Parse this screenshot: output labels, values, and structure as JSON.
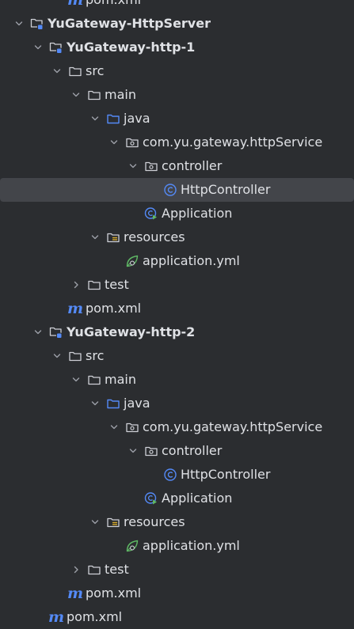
{
  "tree": [
    {
      "label": "pom.xml",
      "icon": "maven-icon",
      "depth": 2,
      "chevron": "none",
      "bold": false
    },
    {
      "label": "YuGateway-HttpServer",
      "icon": "module-folder-icon",
      "depth": 0,
      "chevron": "expanded",
      "bold": true
    },
    {
      "label": "YuGateway-http-1",
      "icon": "module-folder-icon",
      "depth": 1,
      "chevron": "expanded",
      "bold": true
    },
    {
      "label": "src",
      "icon": "folder-icon",
      "depth": 2,
      "chevron": "expanded",
      "bold": false
    },
    {
      "label": "main",
      "icon": "folder-icon",
      "depth": 3,
      "chevron": "expanded",
      "bold": false
    },
    {
      "label": "java",
      "icon": "source-root-folder-icon",
      "depth": 4,
      "chevron": "expanded",
      "bold": false
    },
    {
      "label": "com.yu.gateway.httpService",
      "icon": "package-icon",
      "depth": 5,
      "chevron": "expanded",
      "bold": false
    },
    {
      "label": "controller",
      "icon": "package-icon",
      "depth": 6,
      "chevron": "expanded",
      "bold": false
    },
    {
      "label": "HttpController",
      "icon": "java-class-icon",
      "depth": 7,
      "chevron": "none",
      "bold": false,
      "selected": true
    },
    {
      "label": "Application",
      "icon": "spring-boot-class-icon",
      "depth": 6,
      "chevron": "none",
      "bold": false
    },
    {
      "label": "resources",
      "icon": "resources-folder-icon",
      "depth": 4,
      "chevron": "expanded",
      "bold": false
    },
    {
      "label": "application.yml",
      "icon": "spring-config-icon",
      "depth": 5,
      "chevron": "none",
      "bold": false
    },
    {
      "label": "test",
      "icon": "folder-icon",
      "depth": 3,
      "chevron": "collapsed",
      "bold": false
    },
    {
      "label": "pom.xml",
      "icon": "maven-icon",
      "depth": 2,
      "chevron": "none",
      "bold": false
    },
    {
      "label": "YuGateway-http-2",
      "icon": "module-folder-icon",
      "depth": 1,
      "chevron": "expanded",
      "bold": true
    },
    {
      "label": "src",
      "icon": "folder-icon",
      "depth": 2,
      "chevron": "expanded",
      "bold": false
    },
    {
      "label": "main",
      "icon": "folder-icon",
      "depth": 3,
      "chevron": "expanded",
      "bold": false
    },
    {
      "label": "java",
      "icon": "source-root-folder-icon",
      "depth": 4,
      "chevron": "expanded",
      "bold": false
    },
    {
      "label": "com.yu.gateway.httpService",
      "icon": "package-icon",
      "depth": 5,
      "chevron": "expanded",
      "bold": false
    },
    {
      "label": "controller",
      "icon": "package-icon",
      "depth": 6,
      "chevron": "expanded",
      "bold": false
    },
    {
      "label": "HttpController",
      "icon": "java-class-icon",
      "depth": 7,
      "chevron": "none",
      "bold": false
    },
    {
      "label": "Application",
      "icon": "spring-boot-class-icon",
      "depth": 6,
      "chevron": "none",
      "bold": false
    },
    {
      "label": "resources",
      "icon": "resources-folder-icon",
      "depth": 4,
      "chevron": "expanded",
      "bold": false
    },
    {
      "label": "application.yml",
      "icon": "spring-config-icon",
      "depth": 5,
      "chevron": "none",
      "bold": false
    },
    {
      "label": "test",
      "icon": "folder-icon",
      "depth": 3,
      "chevron": "collapsed",
      "bold": false
    },
    {
      "label": "pom.xml",
      "icon": "maven-icon",
      "depth": 2,
      "chevron": "none",
      "bold": false
    },
    {
      "label": "pom.xml",
      "icon": "maven-icon",
      "depth": 1,
      "chevron": "none",
      "bold": false
    }
  ],
  "colors": {
    "background": "#2b2d30",
    "selection": "#43454a",
    "text": "#dfe1e5",
    "folder_stroke": "#ced0d6",
    "source_root": "#548af7",
    "spring_green": "#5fb865",
    "resources_accent": "#d4a72c",
    "maven_blue": "#548af7"
  }
}
